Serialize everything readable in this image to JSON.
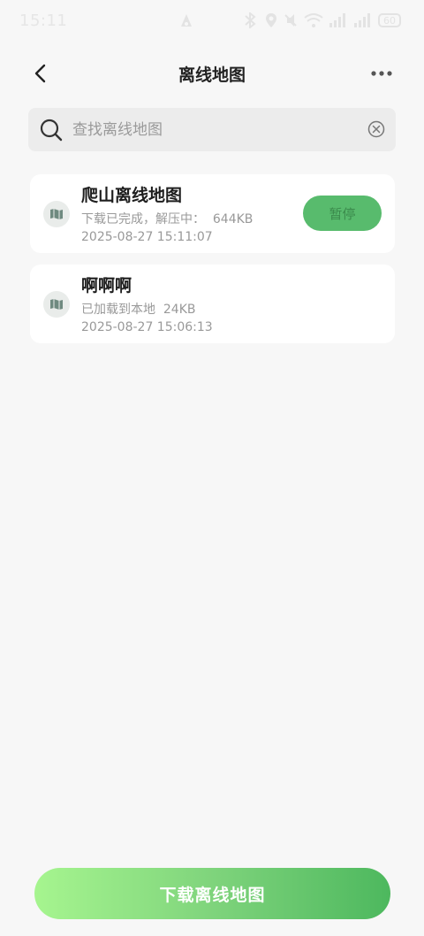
{
  "status_bar": {
    "time": "15:11",
    "battery": "60"
  },
  "header": {
    "title": "离线地图"
  },
  "search": {
    "placeholder": "查找离线地图",
    "value": ""
  },
  "maps": [
    {
      "name": "爬山离线地图",
      "status": "下载已完成，解压中：  644KB",
      "date": "2025-08-27 15:11:07",
      "action_label": "暂停"
    },
    {
      "name": "啊啊啊",
      "status": "已加载到本地  24KB",
      "date": "2025-08-27 15:06:13"
    }
  ],
  "footer": {
    "download_label": "下载离线地图"
  },
  "colors": {
    "accent": "#58bb6d",
    "gradient_start": "#a6f58f",
    "gradient_end": "#4db85e",
    "background": "#f7f7f7"
  },
  "icons": {
    "back": "chevron-left-icon",
    "more": "more-dots-icon",
    "search": "search-icon",
    "clear": "clear-circle-icon",
    "map": "map-icon"
  }
}
